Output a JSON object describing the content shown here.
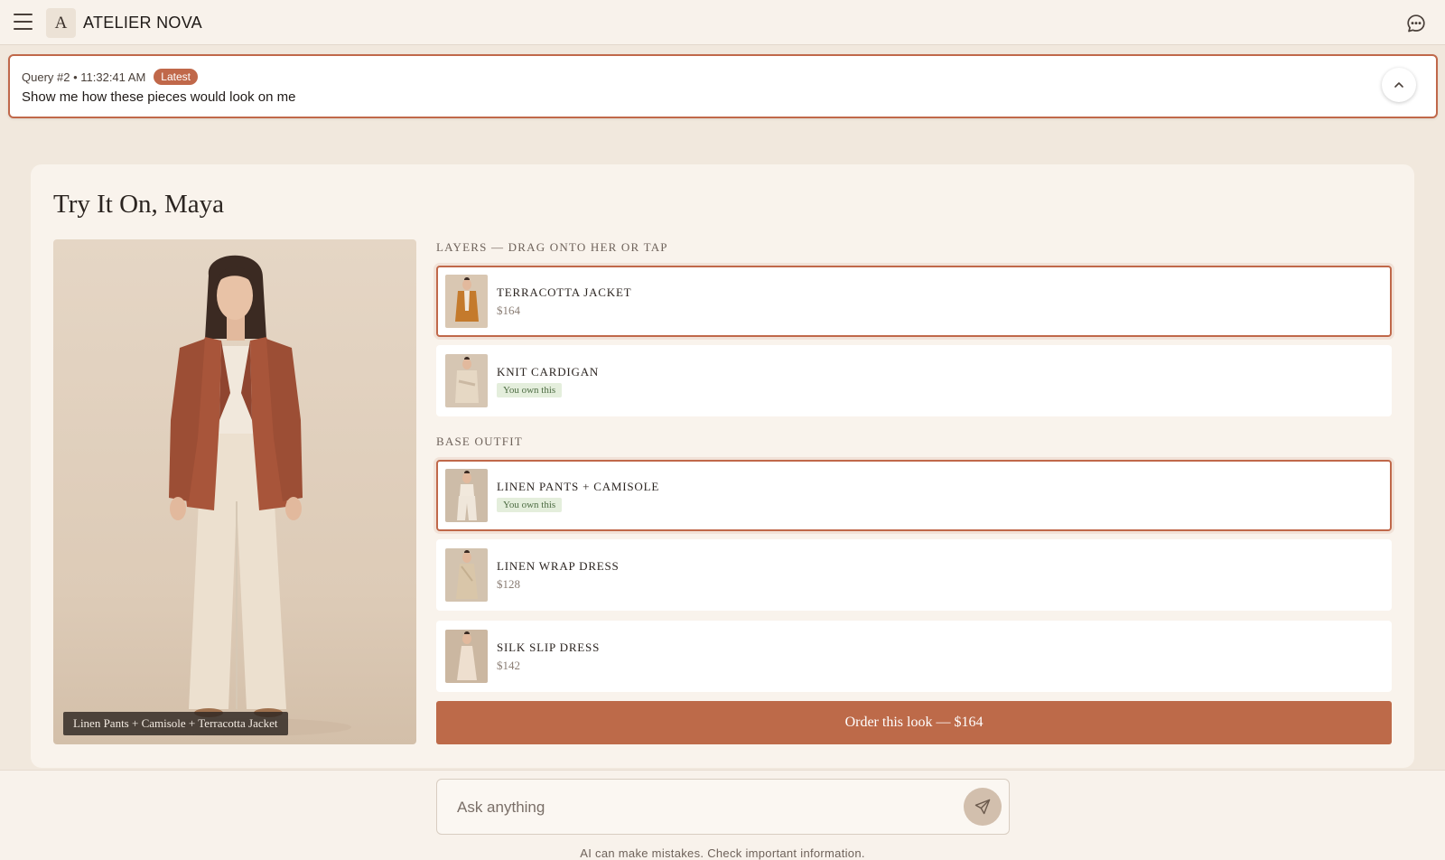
{
  "header": {
    "logo_letter": "A",
    "brand": "ATELIER NOVA",
    "menu_icon": "hamburger-menu-icon",
    "chat_icon": "chat-bubble-icon"
  },
  "query": {
    "meta": "Query #2 • 11:32:41 AM",
    "badge": "Latest",
    "text": "Show me how these pieces would look on me",
    "collapse_icon": "chevron-up-icon"
  },
  "panel": {
    "title": "Try It On, Maya",
    "photo_caption": "Linen Pants + Camisole + Terracotta Jacket",
    "layers_label": "LAYERS — DRAG ONTO HER OR TAP",
    "layers": [
      {
        "name": "TERRACOTTA JACKET",
        "price": "$164",
        "selected": true
      },
      {
        "name": "KNIT CARDIGAN",
        "owned_label": "You own this",
        "selected": false
      }
    ],
    "base_label": "BASE OUTFIT",
    "base": [
      {
        "name": "LINEN PANTS + CAMISOLE",
        "owned_label": "You own this",
        "selected": true
      },
      {
        "name": "LINEN WRAP DRESS",
        "price": "$128",
        "selected": false
      },
      {
        "name": "SILK SLIP DRESS",
        "price": "$142",
        "selected": false
      }
    ],
    "order_button": "Order this look — $164"
  },
  "composer": {
    "placeholder": "Ask anything",
    "send_icon": "send-icon",
    "disclaimer": "AI can make mistakes. Check important information."
  },
  "colors": {
    "accent": "#c0684a",
    "order_button": "#bd6a49",
    "background": "#f1e8dd",
    "owned_badge": "#e4eedc"
  }
}
